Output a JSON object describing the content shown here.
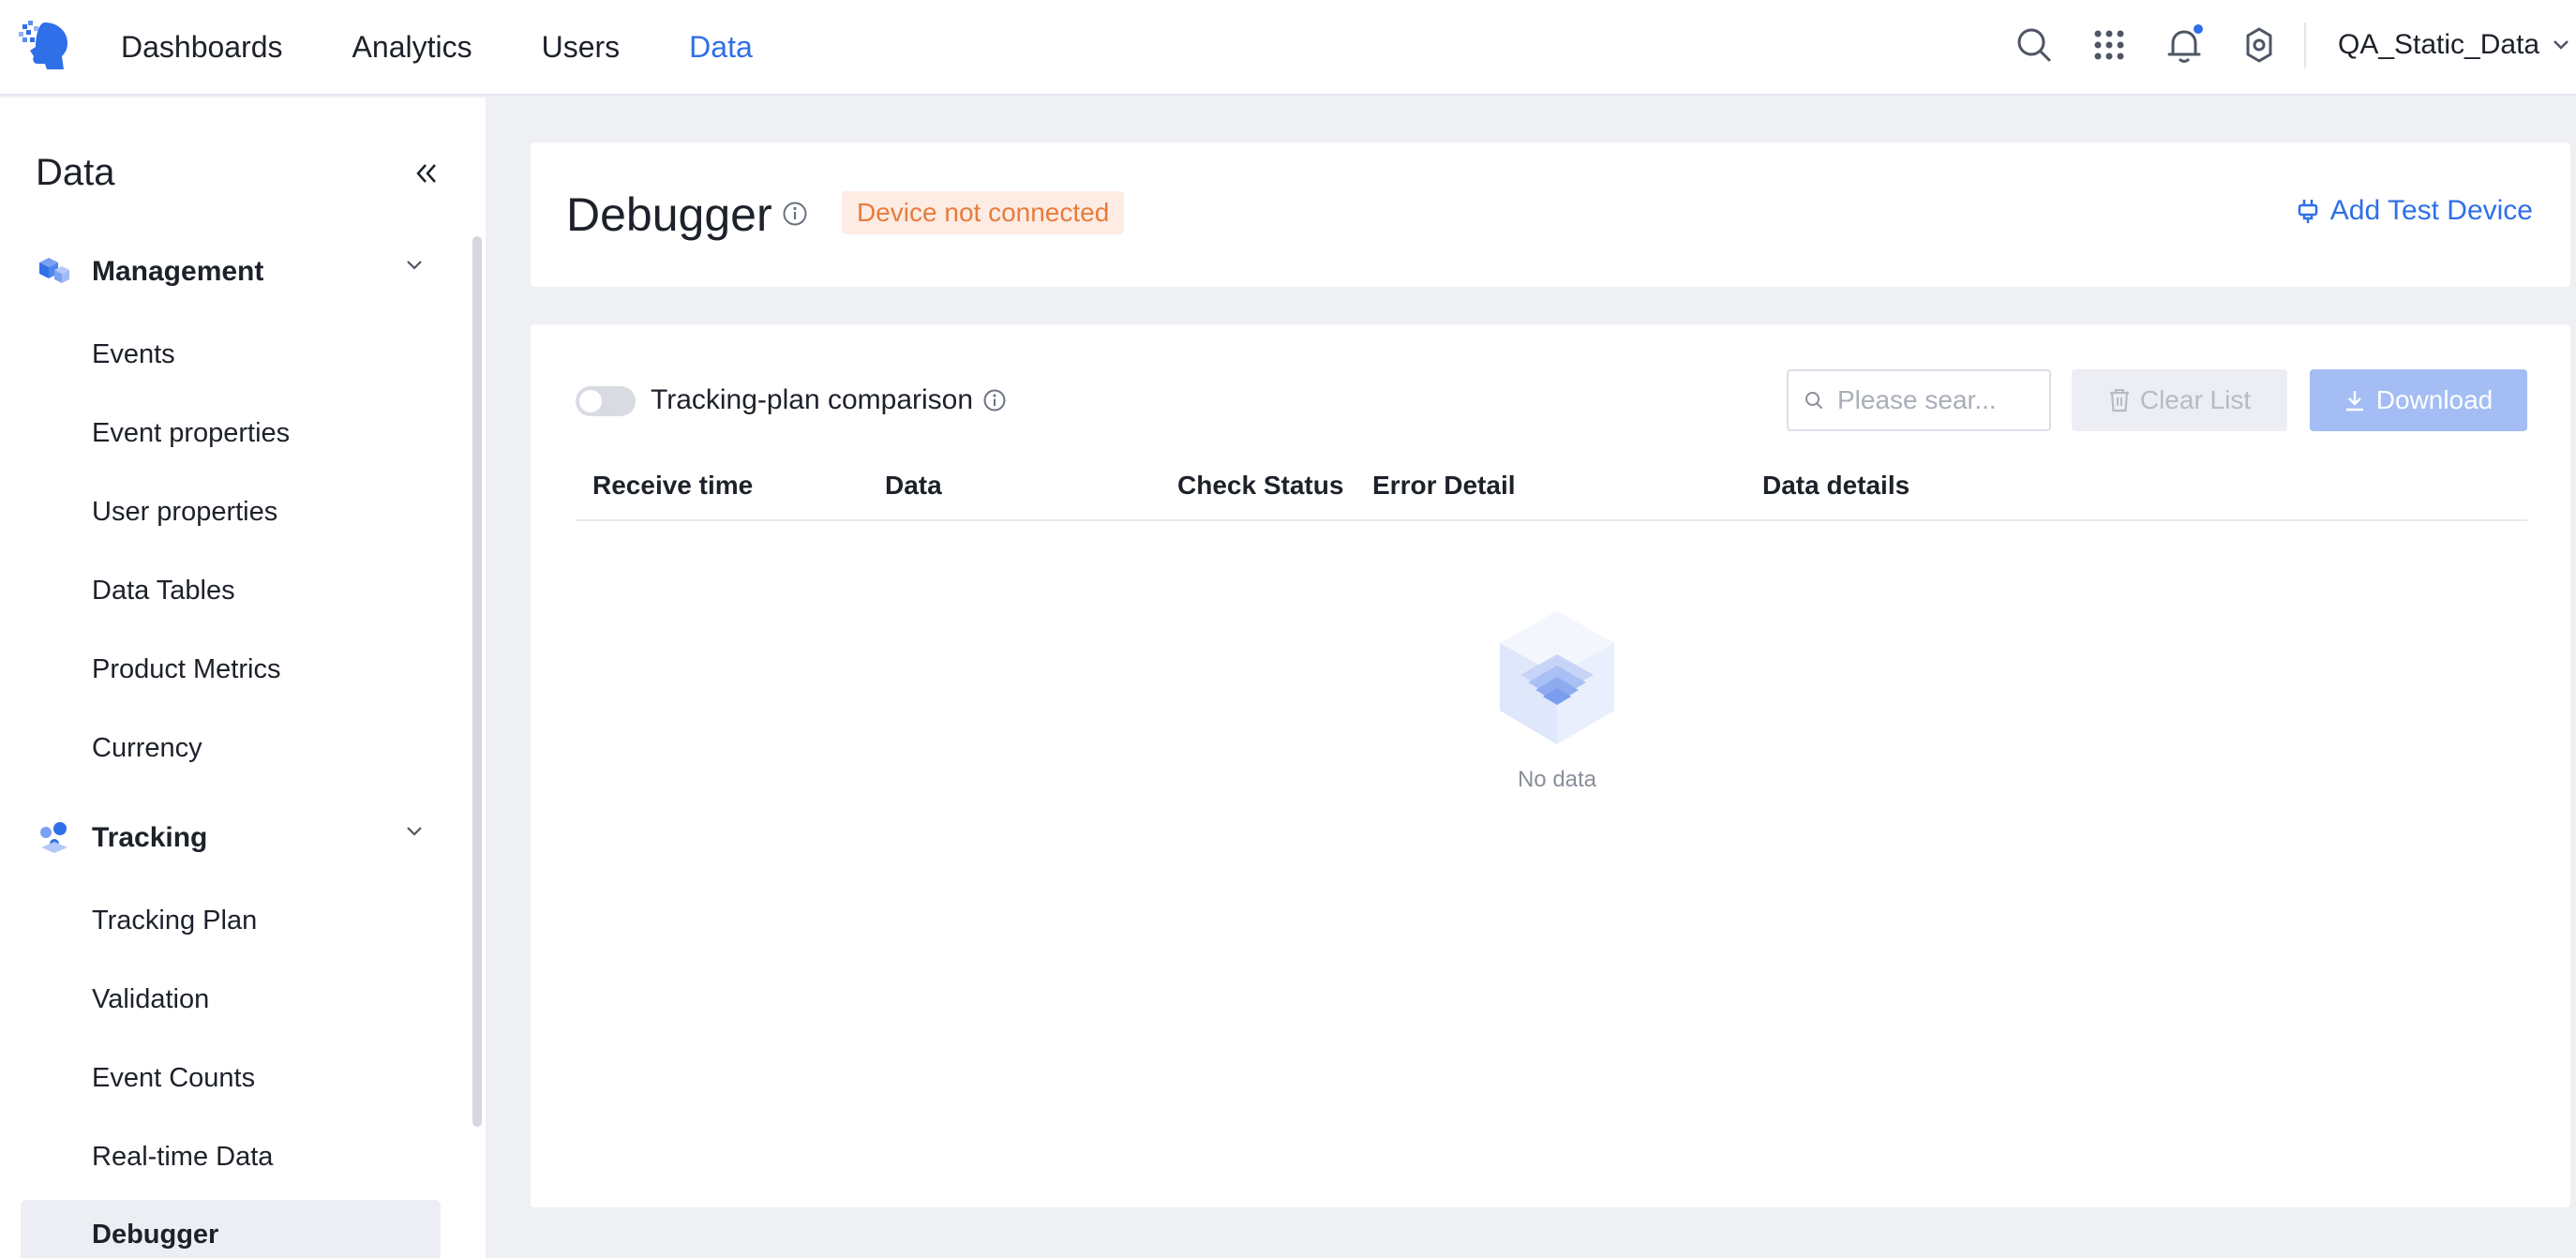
{
  "topbar": {
    "nav": [
      {
        "label": "Dashboards",
        "active": false
      },
      {
        "label": "Analytics",
        "active": false
      },
      {
        "label": "Users",
        "active": false
      },
      {
        "label": "Data",
        "active": true
      }
    ],
    "user": "QA_Static_Data",
    "icons": [
      "search-icon",
      "apps-grid-icon",
      "bell-icon",
      "gear-icon"
    ],
    "notification_dot": true
  },
  "sidebar": {
    "title": "Data",
    "groups": [
      {
        "label": "Management",
        "icon": "cube-icon",
        "items": [
          "Events",
          "Event properties",
          "User properties",
          "Data Tables",
          "Product Metrics",
          "Currency"
        ]
      },
      {
        "label": "Tracking",
        "icon": "tracking-icon",
        "items": [
          "Tracking Plan",
          "Validation",
          "Event Counts",
          "Real-time Data",
          "Debugger"
        ]
      }
    ],
    "active_item": "Debugger"
  },
  "header": {
    "title": "Debugger",
    "status": "Device not connected",
    "add_device": "Add Test Device"
  },
  "toolbar": {
    "toggle_label": "Tracking-plan comparison",
    "toggle_on": false,
    "search_placeholder": "Please sear...",
    "clear_label": "Clear List",
    "download_label": "Download"
  },
  "table": {
    "columns": [
      "Receive time",
      "Data",
      "Check Status",
      "Error Detail",
      "Data details"
    ],
    "rows": [],
    "empty_text": "No data"
  },
  "colors": {
    "accent": "#2f6fe8",
    "status_warning_bg": "#fdece3",
    "status_warning_text": "#e87b3c"
  }
}
